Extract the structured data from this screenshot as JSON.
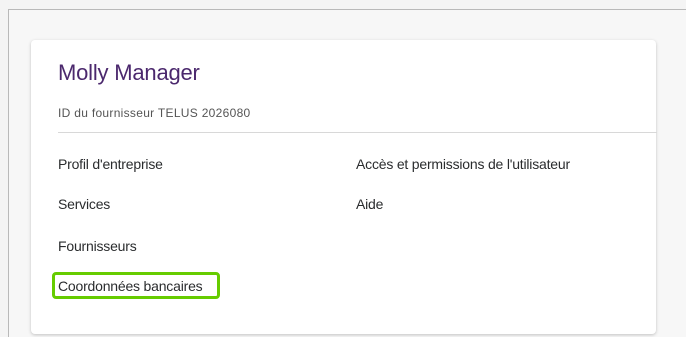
{
  "profile": {
    "name": "Molly Manager",
    "supplier_id": "ID du fournisseur TELUS 2026080"
  },
  "links": {
    "company_profile": "Profil d'entreprise",
    "services": "Services",
    "suppliers": "Fournisseurs",
    "bank_details": "Coordonnées bancaires",
    "user_access": "Accès et permissions de l'utilisateur",
    "help": "Aide"
  },
  "colors": {
    "name": "#4b286d",
    "highlight": "#66cc00"
  }
}
